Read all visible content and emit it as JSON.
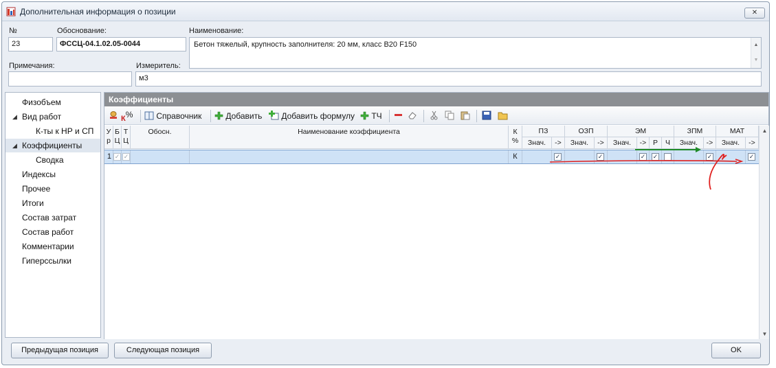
{
  "window": {
    "title": "Дополнительная информация о позиции",
    "close_label": "✕"
  },
  "form": {
    "num_label": "№",
    "num_value": "23",
    "basis_label": "Обоснование:",
    "basis_value": "ФССЦ-04.1.02.05-0044",
    "name_label": "Наименование:",
    "name_value": "Бетон тяжелый, крупность заполнителя: 20 мм, класс В20  F150",
    "notes_label": "Примечания:",
    "notes_value": "",
    "unit_label": "Измеритель:",
    "unit_value": "м3"
  },
  "sidebar": {
    "items": [
      {
        "label": "Физобъем"
      },
      {
        "label": "Вид работ"
      },
      {
        "label": "К-ты к НР и СП"
      },
      {
        "label": "Коэффициенты"
      },
      {
        "label": "Сводка"
      },
      {
        "label": "Индексы"
      },
      {
        "label": "Прочее"
      },
      {
        "label": "Итоги"
      },
      {
        "label": "Состав затрат"
      },
      {
        "label": "Состав работ"
      },
      {
        "label": "Комментарии"
      },
      {
        "label": "Гиперссылки"
      }
    ]
  },
  "section": {
    "title": "Коэффициенты"
  },
  "toolbar": {
    "k_label": "К",
    "percent_label": "%",
    "reference_label": "Справочник",
    "add_label": "Добавить",
    "add_formula_label": "Добавить формулу",
    "tch_label": "ТЧ"
  },
  "grid": {
    "headers": {
      "ur": "У\nр",
      "bc": "Б\nЦ",
      "tc": "Т\nЦ",
      "basis": "Обосн.",
      "name": "Наименование коэффициента",
      "kpct": "К\n%",
      "pz": "ПЗ",
      "ozp": "ОЗП",
      "em": "ЭМ",
      "zpm": "ЗПМ",
      "mat": "МАТ",
      "val": "Знач.",
      "arrow": "->",
      "r": "Р",
      "ch": "Ч"
    },
    "row": {
      "num": "1",
      "k": "К"
    }
  },
  "buttons": {
    "prev": "Предыдущая позиция",
    "next": "Следующая позиция",
    "ok": "OK"
  },
  "colors": {
    "annotation_red": "#e0201f",
    "annotation_green": "#1e8a28",
    "selected_row": "#cfe2f6"
  }
}
